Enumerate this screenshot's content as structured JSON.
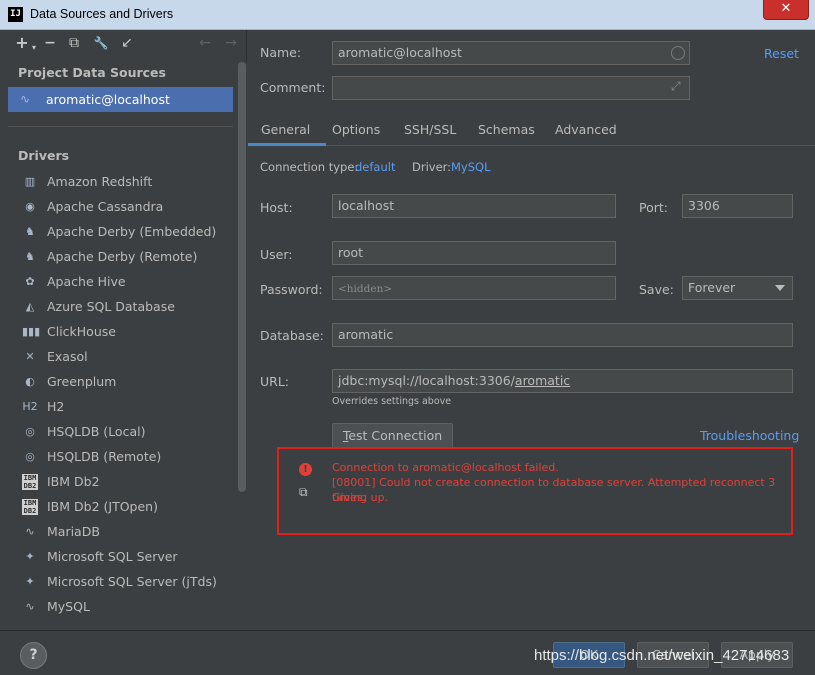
{
  "window": {
    "title": "Data Sources and Drivers",
    "close_glyph": "✕",
    "app_icon_text": "IJ"
  },
  "toolbar": {
    "add": "+",
    "add_caret": "▾",
    "remove": "−",
    "copy": "⧉",
    "settings": "🔧",
    "import": "↙",
    "back": "←",
    "forward": "→"
  },
  "sidebar": {
    "project_title": "Project Data Sources",
    "selected_source": "aromatic@localhost",
    "drivers_title": "Drivers",
    "drivers": [
      {
        "label": "Amazon Redshift",
        "icon": "redshift-icon",
        "glyph": "▥"
      },
      {
        "label": "Apache Cassandra",
        "icon": "cassandra-icon",
        "glyph": "◉"
      },
      {
        "label": "Apache Derby (Embedded)",
        "icon": "derby-icon",
        "glyph": "♞"
      },
      {
        "label": "Apache Derby (Remote)",
        "icon": "derby-icon",
        "glyph": "♞"
      },
      {
        "label": "Apache Hive",
        "icon": "hive-icon",
        "glyph": "✿"
      },
      {
        "label": "Azure SQL Database",
        "icon": "azure-icon",
        "glyph": "◭"
      },
      {
        "label": "ClickHouse",
        "icon": "clickhouse-icon",
        "glyph": "▮▮▮"
      },
      {
        "label": "Exasol",
        "icon": "exasol-icon",
        "glyph": "✕"
      },
      {
        "label": "Greenplum",
        "icon": "greenplum-icon",
        "glyph": "◐"
      },
      {
        "label": "H2",
        "icon": "h2-icon",
        "glyph": "H2"
      },
      {
        "label": "HSQLDB (Local)",
        "icon": "hsqldb-icon",
        "glyph": "◎"
      },
      {
        "label": "HSQLDB (Remote)",
        "icon": "hsqldb-icon",
        "glyph": "◎"
      },
      {
        "label": "IBM Db2",
        "icon": "ibm-db2-icon",
        "glyph": "IBM DB2"
      },
      {
        "label": "IBM Db2 (JTOpen)",
        "icon": "ibm-db2-icon",
        "glyph": "IBM DB2"
      },
      {
        "label": "MariaDB",
        "icon": "mariadb-icon",
        "glyph": "∿"
      },
      {
        "label": "Microsoft SQL Server",
        "icon": "mssql-icon",
        "glyph": "✦"
      },
      {
        "label": "Microsoft SQL Server (jTds)",
        "icon": "mssql-icon",
        "glyph": "✦"
      },
      {
        "label": "MySQL",
        "icon": "mysql-icon",
        "glyph": "∿"
      }
    ]
  },
  "form": {
    "name_label": "Name:",
    "name_value": "aromatic@localhost",
    "reset_label": "Reset",
    "comment_label": "Comment:",
    "comment_value": "",
    "expand_glyph": "⤢",
    "tabs": [
      "General",
      "Options",
      "SSH/SSL",
      "Schemas",
      "Advanced"
    ],
    "connection_type_label": "Connection type:",
    "connection_type_value": "default",
    "driver_label": "Driver:",
    "driver_value": "MySQL",
    "host_label": "Host:",
    "host_value": "localhost",
    "port_label": "Port:",
    "port_value": "3306",
    "user_label": "User:",
    "user_value": "root",
    "password_label": "Password:",
    "password_placeholder": "<hidden>",
    "save_label": "Save:",
    "save_value": "Forever",
    "database_label": "Database:",
    "database_value": "aromatic",
    "url_label": "URL:",
    "url_prefix": "jdbc:mysql://localhost:3306/",
    "url_db": "aromatic",
    "url_hint": "Overrides settings above",
    "test_button_mnemonic": "T",
    "test_button_rest": "est Connection",
    "troubleshooting_label": "Troubleshooting",
    "error": {
      "icon_glyph": "!",
      "copy_glyph": "⧉",
      "line1": "Connection to aromatic@localhost failed.",
      "line2": "[08001] Could not create connection to database server. Attempted reconnect 3 times.",
      "line3": "Giving up."
    }
  },
  "footer": {
    "help_glyph": "?",
    "ok_label": "OK",
    "cancel_label": "Cancel",
    "apply_label": "Apply",
    "watermark": "https://blog.csdn.net/weixin_42714683"
  },
  "colors": {
    "accent": "#4b6eaf",
    "link": "#589df6",
    "error": "#e0403a",
    "error_border": "#e0201b",
    "background": "#3c3f41"
  }
}
